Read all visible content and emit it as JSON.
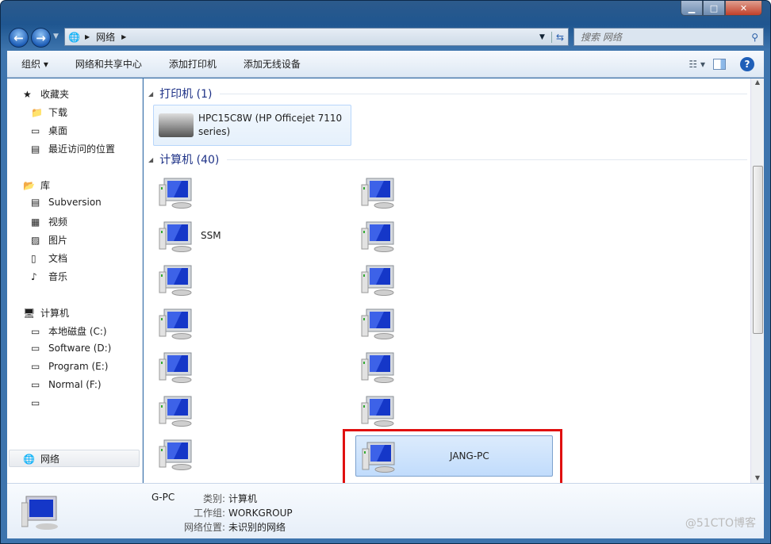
{
  "window": {
    "minimize": "▁",
    "maximize": "□",
    "close": "✕"
  },
  "address": {
    "crumbs": [
      "网络"
    ],
    "search_placeholder": "搜索 网络"
  },
  "toolbar": {
    "organize": "组织 ▾",
    "network_center": "网络和共享中心",
    "add_printer": "添加打印机",
    "add_wireless": "添加无线设备"
  },
  "nav": {
    "favorites": {
      "label": "收藏夹",
      "items": [
        "下载",
        "桌面",
        "最近访问的位置"
      ]
    },
    "libraries": {
      "label": "库",
      "items": [
        "Subversion",
        "视频",
        "图片",
        "文档",
        "音乐"
      ]
    },
    "computer": {
      "label": "计算机",
      "items": [
        "本地磁盘 (C:)",
        "Software (D:)",
        "Program (E:)",
        "Normal (F:)",
        ""
      ]
    },
    "network": {
      "label": "网络"
    }
  },
  "content": {
    "printers": {
      "header": "打印机 (1)",
      "items": [
        {
          "name": "HPC15C8W (HP Officejet 7110 series)"
        }
      ]
    },
    "computers": {
      "header": "计算机 (40)",
      "items": [
        {
          "name": ""
        },
        {
          "name": "SSM"
        },
        {
          "name": ""
        },
        {
          "name": ""
        },
        {
          "name": ""
        },
        {
          "name": ""
        },
        {
          "name": ""
        },
        {
          "name": ""
        },
        {
          "name": ""
        },
        {
          "name": ""
        },
        {
          "name": ""
        },
        {
          "name": ""
        },
        {
          "name": ""
        },
        {
          "name": "JANG-PC",
          "selected": true
        }
      ]
    }
  },
  "details": {
    "name": "G-PC",
    "type_label": "类别:",
    "type": "计算机",
    "workgroup_label": "工作组:",
    "workgroup": "WORKGROUP",
    "location_label": "网络位置:",
    "location": "未识别的网络"
  },
  "watermark": "@51CTO博客",
  "colors": {
    "highlight_box": "#e01010",
    "selection": "#c1dcfc"
  }
}
